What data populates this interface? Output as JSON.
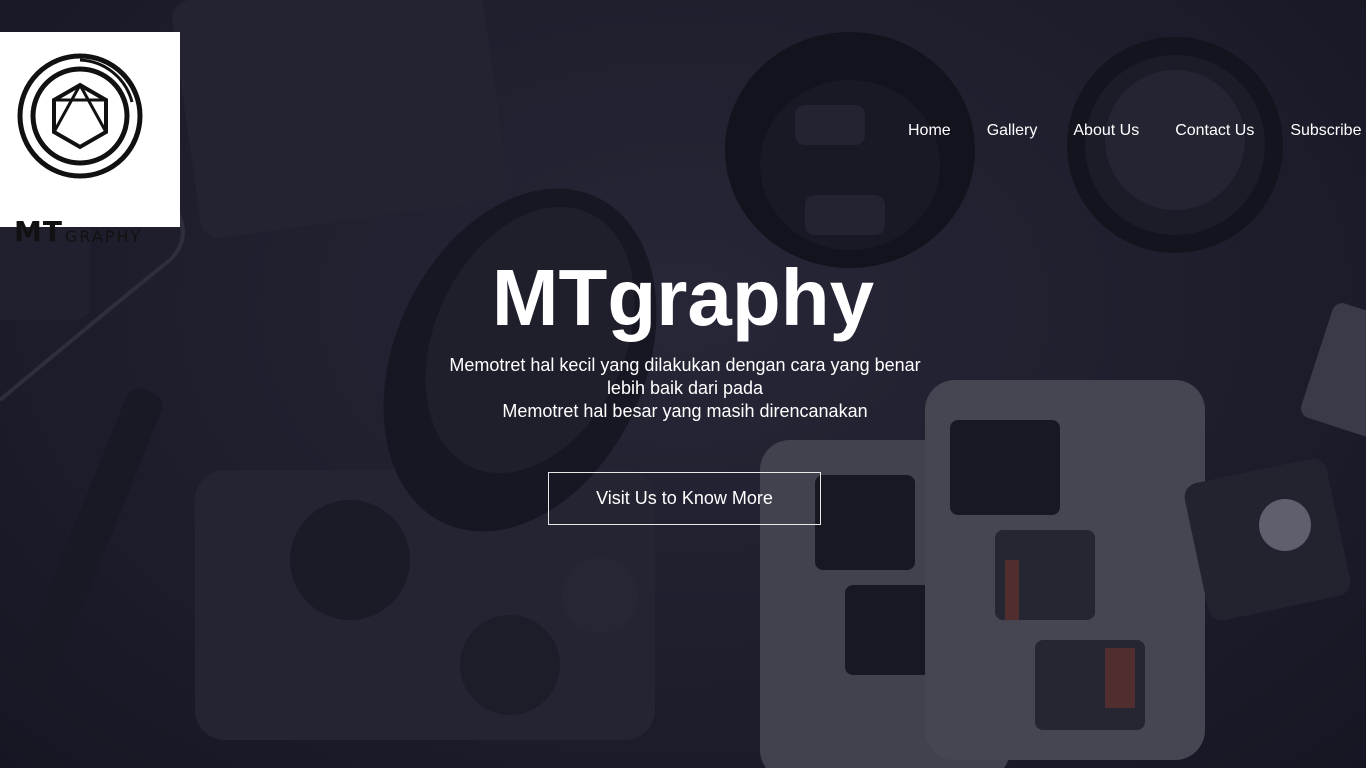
{
  "brand": {
    "logo_mt": "MT",
    "logo_graphy": "GRAPHY"
  },
  "nav": {
    "items": [
      {
        "label": "Home"
      },
      {
        "label": "Gallery"
      },
      {
        "label": "About Us"
      },
      {
        "label": "Contact Us"
      },
      {
        "label": "Subscribe"
      }
    ]
  },
  "hero": {
    "title": "MTgraphy",
    "tagline": [
      "Memotret hal kecil yang dilakukan dengan cara yang benar",
      "lebih baik dari pada",
      "Memotret hal besar yang masih direncanakan"
    ],
    "cta_label": "Visit Us to Know More",
    "background_image": "camera-gear-flatlay"
  },
  "colors": {
    "background": "#1e1e2a",
    "text": "#ffffff",
    "logo_box": "#ffffff",
    "button_border": "#e8e8e8"
  }
}
